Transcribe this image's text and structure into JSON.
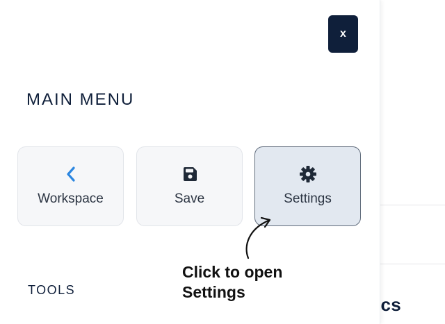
{
  "drawer": {
    "close_label": "x",
    "title": "MAIN MENU",
    "tiles": [
      {
        "label": "Workspace",
        "icon": "chevron-left-icon",
        "icon_color": "#2b86e0"
      },
      {
        "label": "Save",
        "icon": "floppy-disk-icon",
        "icon_color": "#1f2937"
      },
      {
        "label": "Settings",
        "icon": "gear-icon",
        "icon_color": "#1f2937",
        "selected": true
      }
    ],
    "tools_title": "TOOLS"
  },
  "callout": {
    "line1": "Click to open",
    "line2": "Settings"
  },
  "background": {
    "partial_heading": "ics"
  },
  "colors": {
    "accent_dark": "#0f1f3a",
    "selected_tile_bg": "#e2e8f0",
    "tile_bg": "#f6f7f9",
    "chevron_blue": "#2b86e0"
  }
}
